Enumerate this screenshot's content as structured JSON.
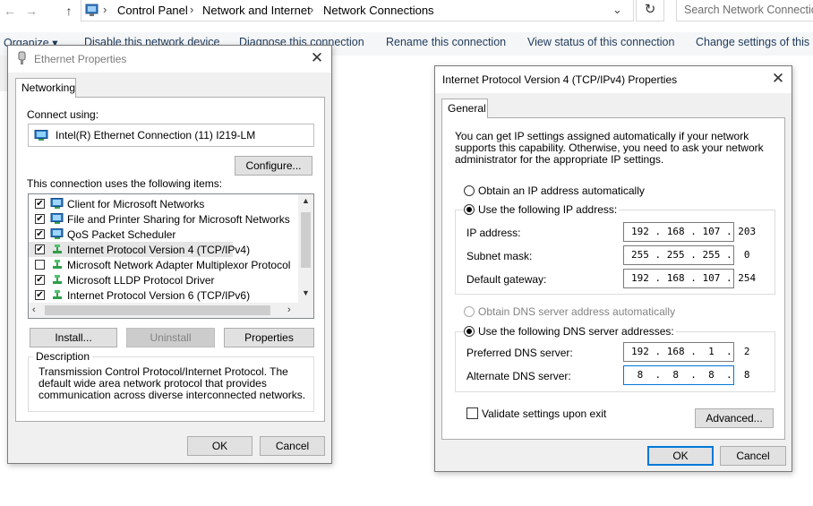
{
  "explorer": {
    "breadcrumbs": [
      "Control Panel",
      "Network and Internet",
      "Network Connections"
    ],
    "search_placeholder": "Search Network Connections",
    "commands": [
      "Organize ▾",
      "Disable this network device",
      "Diagnose this connection",
      "Rename this connection",
      "View status of this connection",
      "Change settings of this c"
    ]
  },
  "eth": {
    "title": "Ethernet Properties",
    "tab": "Networking",
    "connect_using_label": "Connect using:",
    "adapter": "Intel(R) Ethernet Connection (11) I219-LM",
    "configure": "Configure...",
    "items_label": "This connection uses the following items:",
    "items": [
      {
        "label": "Client for Microsoft Networks",
        "checked": true
      },
      {
        "label": "File and Printer Sharing for Microsoft Networks",
        "checked": true
      },
      {
        "label": "QoS Packet Scheduler",
        "checked": true
      },
      {
        "label": "Internet Protocol Version 4 (TCP/IPv4)",
        "checked": true
      },
      {
        "label": "Microsoft Network Adapter Multiplexor Protocol",
        "checked": false
      },
      {
        "label": "Microsoft LLDP Protocol Driver",
        "checked": true
      },
      {
        "label": "Internet Protocol Version 6 (TCP/IPv6)",
        "checked": true
      }
    ],
    "install": "Install...",
    "uninstall": "Uninstall",
    "properties": "Properties",
    "description_label": "Description",
    "description": "Transmission Control Protocol/Internet Protocol. The default wide area network protocol that provides communication across diverse interconnected networks.",
    "ok": "OK",
    "cancel": "Cancel"
  },
  "ipv4": {
    "title": "Internet Protocol Version 4 (TCP/IPv4) Properties",
    "tab": "General",
    "intro": "You can get IP settings assigned automatically if your network supports this capability. Otherwise, you need to ask your network administrator for the appropriate IP settings.",
    "obtain_ip": "Obtain an IP address automatically",
    "use_ip": "Use the following IP address:",
    "ip_label": "IP address:",
    "ip_value": "192 . 168 . 107 . 203",
    "subnet_label": "Subnet mask:",
    "subnet_value": "255 . 255 . 255 .  0",
    "gateway_label": "Default gateway:",
    "gateway_value": "192 . 168 . 107 . 254",
    "obtain_dns": "Obtain DNS server address automatically",
    "use_dns": "Use the following DNS server addresses:",
    "pref_dns_label": "Preferred DNS server:",
    "pref_dns_value": "192 . 168 .  1  .  2",
    "alt_dns_label": "Alternate DNS server:",
    "alt_dns_value": " 8  .  8  .  8  .  8",
    "validate": "Validate settings upon exit",
    "advanced": "Advanced...",
    "ok": "OK",
    "cancel": "Cancel"
  }
}
